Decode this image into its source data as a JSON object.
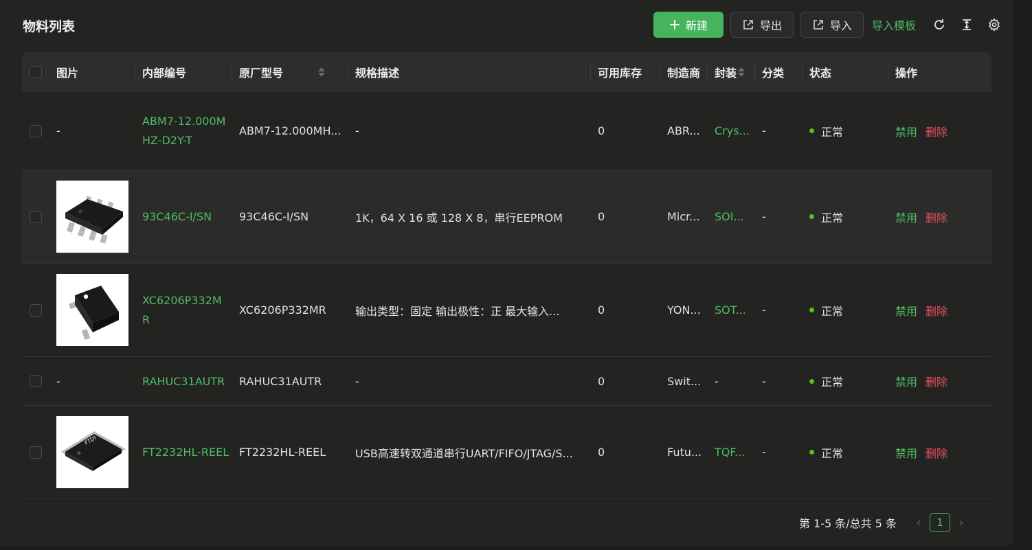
{
  "header": {
    "title": "物料列表",
    "new_label": "新建",
    "export_label": "导出",
    "import_label": "导入",
    "import_template_label": "导入模板"
  },
  "columns": {
    "image": "图片",
    "internal_no": "内部编号",
    "mfr_part": "原厂型号",
    "spec": "规格描述",
    "stock": "可用库存",
    "manufacturer": "制造商",
    "package": "封装",
    "category": "分类",
    "status": "状态",
    "actions": "操作"
  },
  "rows": [
    {
      "image": "-",
      "internal_no": "ABM7-12.000MHZ-D2Y-T",
      "mfr_part": "ABM7-12.000MH...",
      "spec": "-",
      "stock": "0",
      "manufacturer": "ABR...",
      "package": "Crys...",
      "category": "-",
      "status": "正常",
      "disable": "禁用",
      "delete": "删除"
    },
    {
      "image": "soic-8-chip",
      "internal_no": "93C46C-I/SN",
      "mfr_part": "93C46C-I/SN",
      "spec": "1K，64 X 16 或 128 X 8，串行EEPROM",
      "stock": "0",
      "manufacturer": "Micr...",
      "package": "SOI...",
      "category": "-",
      "status": "正常",
      "disable": "禁用",
      "delete": "删除"
    },
    {
      "image": "sot-23-chip",
      "internal_no": "XC6206P332MR",
      "mfr_part": "XC6206P332MR",
      "spec": "输出类型：固定 输出极性：正 最大输入...",
      "stock": "0",
      "manufacturer": "YON...",
      "package": "SOT...",
      "category": "-",
      "status": "正常",
      "disable": "禁用",
      "delete": "删除"
    },
    {
      "image": "-",
      "internal_no": "RAHUC31AUTR",
      "mfr_part": "RAHUC31AUTR",
      "spec": "-",
      "stock": "0",
      "manufacturer": "Swit...",
      "package": "-",
      "category": "-",
      "status": "正常",
      "disable": "禁用",
      "delete": "删除"
    },
    {
      "image": "tqfp-ftdi-chip",
      "internal_no": "FT2232HL-REEL",
      "mfr_part": "FT2232HL-REEL",
      "spec": "USB高速转双通道串行UART/FIFO/JTAG/S...",
      "stock": "0",
      "manufacturer": "Futu...",
      "package": "TQF...",
      "category": "-",
      "status": "正常",
      "disable": "禁用",
      "delete": "删除"
    }
  ],
  "pagination": {
    "summary": "第 1-5 条/总共 5 条",
    "current_page": "1"
  },
  "colors": {
    "accent": "#47b35d",
    "link": "#4fbd63",
    "danger": "#e0505b",
    "status_ok": "#52c41a"
  }
}
